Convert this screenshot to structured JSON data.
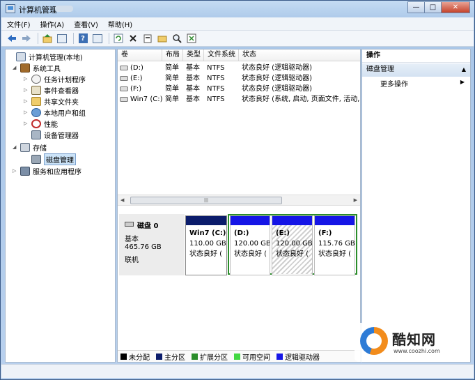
{
  "window": {
    "title": "计算机管理",
    "buttons": {
      "minimize": "—",
      "maximize": "□",
      "close": "✕"
    }
  },
  "menu": [
    "文件(F)",
    "操作(A)",
    "查看(V)",
    "帮助(H)"
  ],
  "toolbar": {
    "icons": [
      "back-arrow-icon",
      "forward-arrow-icon",
      "up-folder-icon",
      "console-tree-icon",
      "help-icon",
      "properties-icon",
      "refresh-icon",
      "delete-icon",
      "properties-sheet-icon",
      "open-folder-icon",
      "search-icon",
      "export-icon"
    ]
  },
  "tree": [
    {
      "label": "计算机管理(本地)",
      "level": 0,
      "twisty": "",
      "icon": "computer-icon"
    },
    {
      "label": "系统工具",
      "level": 1,
      "twisty": "◢",
      "icon": "tools-icon"
    },
    {
      "label": "任务计划程序",
      "level": 2,
      "twisty": "▷",
      "icon": "clock-icon"
    },
    {
      "label": "事件查看器",
      "level": 2,
      "twisty": "▷",
      "icon": "event-log-icon"
    },
    {
      "label": "共享文件夹",
      "level": 2,
      "twisty": "▷",
      "icon": "shared-folder-icon"
    },
    {
      "label": "本地用户和组",
      "level": 2,
      "twisty": "▷",
      "icon": "users-icon"
    },
    {
      "label": "性能",
      "level": 2,
      "twisty": "▷",
      "icon": "performance-icon"
    },
    {
      "label": "设备管理器",
      "level": 2,
      "twisty": "",
      "icon": "device-manager-icon"
    },
    {
      "label": "存储",
      "level": 1,
      "twisty": "◢",
      "icon": "storage-icon"
    },
    {
      "label": "磁盘管理",
      "level": 2,
      "twisty": "",
      "icon": "disk-management-icon",
      "selected": true
    },
    {
      "label": "服务和应用程序",
      "level": 1,
      "twisty": "▷",
      "icon": "services-icon"
    }
  ],
  "volumes": {
    "columns": [
      "卷",
      "布局",
      "类型",
      "文件系统",
      "状态"
    ],
    "rows": [
      [
        "(D:)",
        "简单",
        "基本",
        "NTFS",
        "状态良好 (逻辑驱动器)"
      ],
      [
        "(E:)",
        "简单",
        "基本",
        "NTFS",
        "状态良好 (逻辑驱动器)"
      ],
      [
        "(F:)",
        "简单",
        "基本",
        "NTFS",
        "状态良好 (逻辑驱动器)"
      ],
      [
        "Win7 (C:)",
        "简单",
        "基本",
        "NTFS",
        "状态良好 (系统, 启动, 页面文件, 活动,"
      ]
    ]
  },
  "disk": {
    "name": "磁盘 0",
    "type": "基本",
    "size": "465.76 GB",
    "state": "联机",
    "partitions": [
      {
        "name": "Win7 (C:)",
        "size": "110.00 GB",
        "status": "状态良好 (",
        "bar_color": "#0b1c6b"
      },
      {
        "name": "(D:)",
        "size": "120.00 GB",
        "status": "状态良好 (",
        "bar_color": "#1515e6"
      },
      {
        "name": "(E:)",
        "size": "120.00 GB",
        "status": "状态良好 (",
        "bar_color": "#1515e6",
        "selected": true
      },
      {
        "name": "(F:)",
        "size": "115.76 GB",
        "status": "状态良好 (",
        "bar_color": "#1515e6"
      }
    ]
  },
  "legend": [
    {
      "label": "未分配",
      "color": "#000000"
    },
    {
      "label": "主分区",
      "color": "#0b1c6b"
    },
    {
      "label": "扩展分区",
      "color": "#2a8d2a"
    },
    {
      "label": "可用空间",
      "color": "#43d843"
    },
    {
      "label": "逻辑驱动器",
      "color": "#1515e6"
    }
  ],
  "actions": {
    "header": "操作",
    "section": "磁盘管理",
    "more": "更多操作"
  },
  "watermark": {
    "title": "酷知网",
    "url": "www.coozhi.com"
  }
}
